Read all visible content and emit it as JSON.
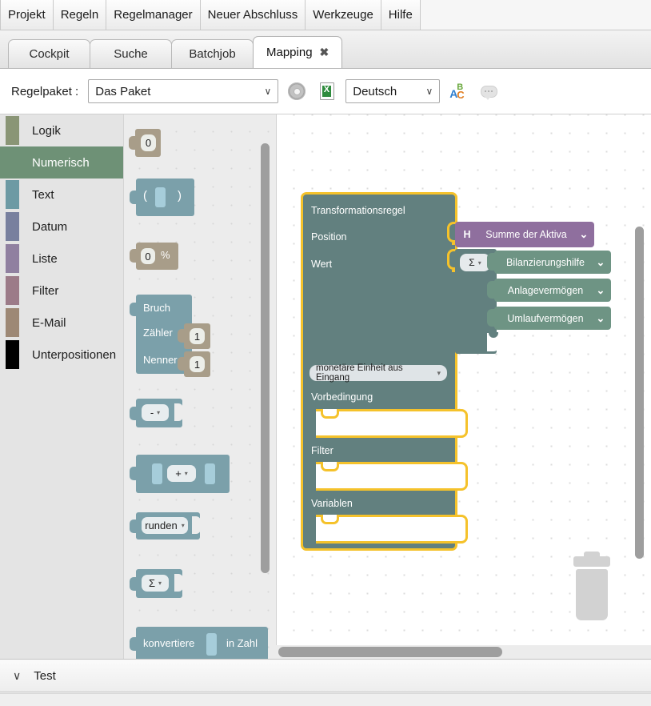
{
  "menubar": {
    "items": [
      {
        "label": "Projekt"
      },
      {
        "label": "Regeln"
      },
      {
        "label": "Regelmanager"
      },
      {
        "label": "Neuer Abschluss"
      },
      {
        "label": "Werkzeuge"
      },
      {
        "label": "Hilfe"
      }
    ]
  },
  "tabs": [
    {
      "label": "Cockpit",
      "active": false,
      "closable": false
    },
    {
      "label": "Suche",
      "active": false,
      "closable": false
    },
    {
      "label": "Batchjob",
      "active": false,
      "closable": false
    },
    {
      "label": "Mapping",
      "active": true,
      "closable": true,
      "close_glyph": "✖"
    }
  ],
  "toolbar": {
    "package_label": "Regelpaket :",
    "package_value": "Das Paket",
    "package_caret": "∨",
    "settings_icon": "gear-icon",
    "export_icon": "excel-export-icon",
    "language_value": "Deutsch",
    "language_caret": "∨",
    "translate_icon": "abc-translate-icon",
    "comment_icon": "comment-bubble-icon",
    "abc_a": "A",
    "abc_b": "B",
    "abc_c": "C"
  },
  "sidebar": {
    "items": [
      {
        "label": "Logik",
        "color": "#8a9576",
        "selected": false
      },
      {
        "label": "Numerisch",
        "color": "#6e9176",
        "selected": true
      },
      {
        "label": "Text",
        "color": "#6d9aa4",
        "selected": false
      },
      {
        "label": "Datum",
        "color": "#78809e",
        "selected": false
      },
      {
        "label": "Liste",
        "color": "#9080a0",
        "selected": false
      },
      {
        "label": "Filter",
        "color": "#9c7b88",
        "selected": false
      },
      {
        "label": "E-Mail",
        "color": "#9d8875",
        "selected": false
      },
      {
        "label": "Unterpositionen",
        "color": "#000000",
        "selected": false
      }
    ]
  },
  "palette": {
    "blocks": [
      {
        "name": "number-block",
        "value": "0"
      },
      {
        "name": "parentheses-block",
        "left": "(",
        "right": ")"
      },
      {
        "name": "percent-block",
        "value": "0",
        "suffix": "%"
      },
      {
        "name": "fraction-block",
        "title": "Bruch",
        "numerator_label": "Zähler",
        "numerator_value": "1",
        "denominator_label": "Nenner",
        "denominator_value": "1"
      },
      {
        "name": "negate-block",
        "value": "-",
        "caret": "▾"
      },
      {
        "name": "arithmetic-block",
        "value": "+",
        "caret": "▾"
      },
      {
        "name": "round-block",
        "value": "runden",
        "caret": "▾"
      },
      {
        "name": "sum-block",
        "value": "Σ",
        "caret": "▾"
      },
      {
        "name": "convert-block",
        "prefix": "konvertiere",
        "suffix": "in Zahl"
      }
    ]
  },
  "canvas": {
    "rule": {
      "title": "Transformationsregel",
      "rows": [
        {
          "label": "Position"
        },
        {
          "label": "Wert"
        }
      ],
      "unit_pill": "monetäre Einheit aus Eingang",
      "unit_caret": "▾",
      "sections": [
        {
          "label": "Vorbedingung"
        },
        {
          "label": "Filter"
        },
        {
          "label": "Variablen"
        }
      ],
      "border_color": "#f5c22b",
      "body_color": "#62807f"
    },
    "position_block": {
      "prefix": "H",
      "label": "Summe der Aktiva",
      "caret": "⌄",
      "color": "#8f6f9e"
    },
    "sum_container": {
      "symbol": "Σ",
      "caret": "▾"
    },
    "list_items": [
      {
        "label": "Bilanzierungshilfe",
        "caret": "⌄",
        "color": "#6e9484"
      },
      {
        "label": "Anlagevermögen",
        "caret": "⌄",
        "color": "#6e9484"
      },
      {
        "label": "Umlaufvermögen",
        "caret": "⌄",
        "color": "#6e9484"
      }
    ],
    "trash_icon": "trash-can-icon"
  },
  "bottom": {
    "toggle_caret": "∨",
    "test_label": "Test"
  }
}
